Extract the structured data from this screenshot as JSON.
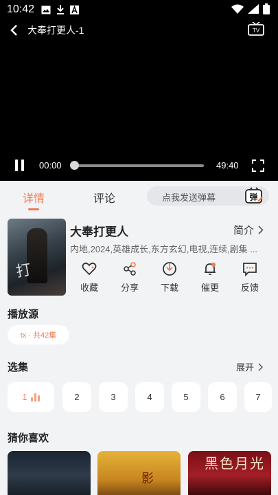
{
  "status_bar": {
    "time": "10:42"
  },
  "player": {
    "title": "大奉打更人-1",
    "current_time": "00:00",
    "total_time": "49:40",
    "progress": 0.0
  },
  "tabs": {
    "detail": "详情",
    "comment": "评论"
  },
  "danmu": {
    "placeholder": "点我发送弹幕",
    "icon_text": "弹"
  },
  "show": {
    "title": "大奉打更人",
    "intro_label": "简介",
    "tags": "内地,2024,英雄成长,东方玄幻,电视,连续,剧集 ..."
  },
  "actions": [
    {
      "label": "收藏",
      "icon": "heart-icon"
    },
    {
      "label": "分享",
      "icon": "share-icon"
    },
    {
      "label": "下载",
      "icon": "download-icon"
    },
    {
      "label": "催更",
      "icon": "bell-icon"
    },
    {
      "label": "反馈",
      "icon": "feedback-icon"
    }
  ],
  "source": {
    "title": "播放源",
    "chip": "tx · 共42集"
  },
  "episodes": {
    "title": "选集",
    "expand_label": "展开",
    "items": [
      "1",
      "2",
      "3",
      "4",
      "5",
      "6",
      "7"
    ]
  },
  "recommend": {
    "title": "猜你喜欢",
    "item3_title": "黑色月光"
  },
  "colors": {
    "accent": "#f47a4b",
    "background": "#f2f3f5"
  }
}
